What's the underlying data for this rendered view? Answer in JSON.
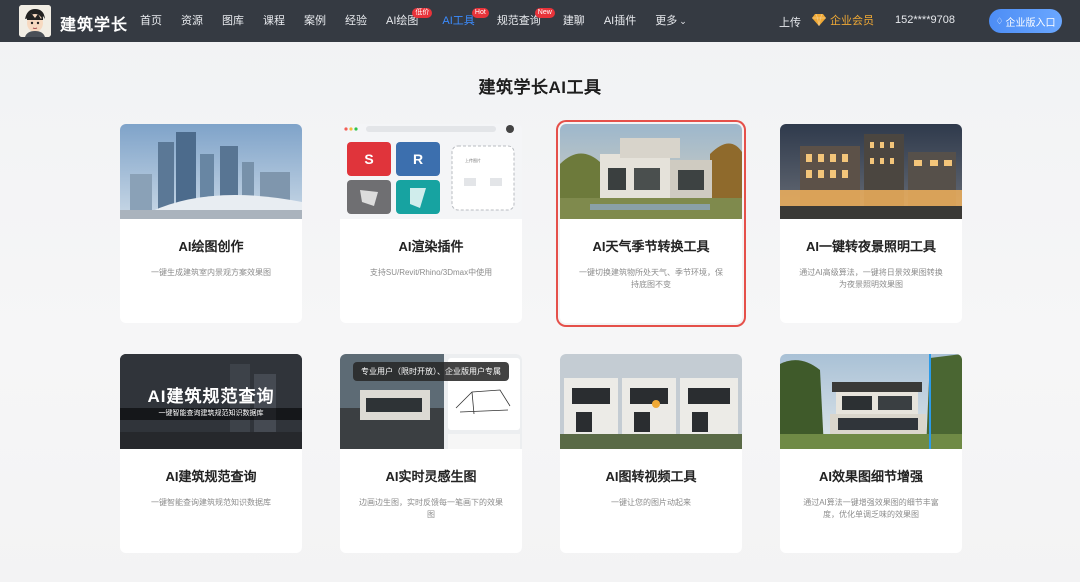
{
  "brand": {
    "name": "建筑学长"
  },
  "nav": {
    "items": [
      {
        "label": "首页"
      },
      {
        "label": "资源"
      },
      {
        "label": "图库"
      },
      {
        "label": "课程"
      },
      {
        "label": "案例"
      },
      {
        "label": "经验"
      },
      {
        "label": "AI绘图",
        "badge": "低价"
      },
      {
        "label": "AI工具",
        "badge": "Hot"
      },
      {
        "label": "规范查询",
        "badge": "New"
      },
      {
        "label": "建聊"
      },
      {
        "label": "AI插件"
      },
      {
        "label": "更多"
      }
    ],
    "active": "AI工具",
    "upload": "上传",
    "vip": "企业会员",
    "phone": "152****9708",
    "enterprise_btn": "企业版入口"
  },
  "page": {
    "title": "建筑学长AI工具"
  },
  "tooltip": "专业用户（限时开放）、企业版用户专属",
  "cards": [
    {
      "title": "AI绘图创作",
      "desc": "一键生成建筑室内景观方案效果图"
    },
    {
      "title": "AI渲染插件",
      "desc": "支持SU/Revit/Rhino/3Dmax中使用"
    },
    {
      "title": "AI天气季节转换工具",
      "desc": "一键切换建筑物所处天气、季节环境，保持底图不变"
    },
    {
      "title": "AI一键转夜景照明工具",
      "desc": "通过AI高级算法，一键将日景效果图转换为夜景照明效果图"
    },
    {
      "title": "AI建筑规范查询",
      "desc": "一键智能查询建筑规范知识数据库"
    },
    {
      "title": "AI实时灵感生图",
      "desc": "边画边生图，实时反馈每一笔画下的效果图"
    },
    {
      "title": "AI图转视频工具",
      "desc": "一键让您的图片动起来"
    },
    {
      "title": "AI效果图细节增强",
      "desc": "通过AI算法一键增强效果图的细节丰富度，优化单调乏味的效果图"
    }
  ],
  "thumb_text": {
    "spec_banner": "AI建筑规范查询",
    "spec_sub": "一键智能查询建筑规范知识数据库",
    "upload_hint": "上传图片"
  },
  "colors": {
    "nav_bg": "#353a42",
    "active": "#3b8cff",
    "vip": "#f0a935",
    "highlight": "#e5504a"
  }
}
